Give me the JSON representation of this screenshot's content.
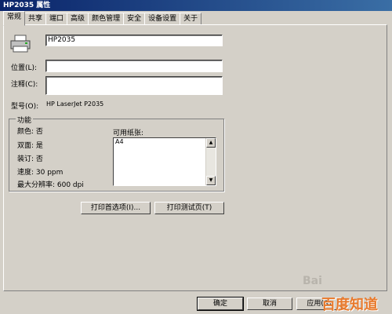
{
  "window": {
    "title": "HP2035 属性"
  },
  "tabs": [
    "常规",
    "共享",
    "端口",
    "高级",
    "颜色管理",
    "安全",
    "设备设置",
    "关于"
  ],
  "general": {
    "printer_name": "HP2035",
    "location_label": "位置(L):",
    "location_value": "",
    "comment_label": "注释(C):",
    "comment_value": "",
    "model_label": "型号(O):",
    "model_value": "HP LaserJet P2035"
  },
  "features": {
    "title": "功能",
    "color": "颜色: 否",
    "duplex": "双面: 是",
    "staple": "装订: 否",
    "speed": "速度: 30 ppm",
    "resolution": "最大分辨率: 600 dpi",
    "paper_label": "可用纸张:",
    "paper_items": [
      "A4"
    ]
  },
  "buttons": {
    "preferences": "打印首选项(I)...",
    "test_page": "打印测试页(T)",
    "ok": "确定",
    "cancel": "取消",
    "apply": "应用(A)"
  },
  "watermark": {
    "brand": "Bai",
    "site": "百度知道"
  },
  "icons": {
    "printer": "printer-icon",
    "scroll_up": "arrow-up-icon",
    "scroll_down": "arrow-down-icon"
  }
}
